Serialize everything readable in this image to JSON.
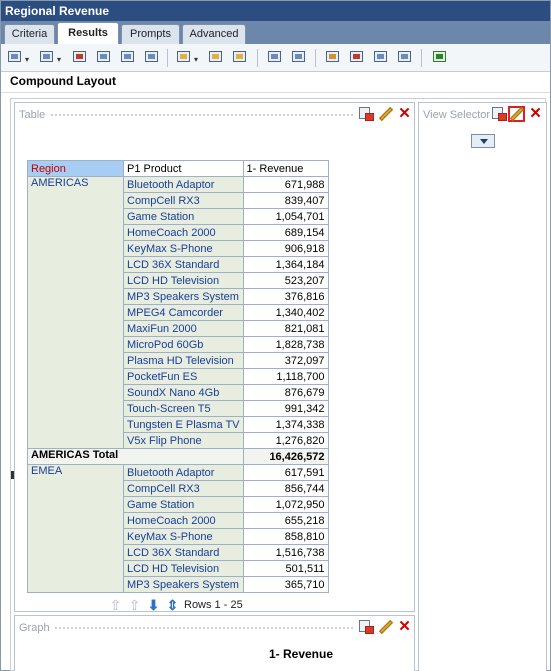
{
  "window": {
    "title": "Regional Revenue"
  },
  "tabs": [
    {
      "label": "Criteria",
      "active": false
    },
    {
      "label": "Results",
      "active": true
    },
    {
      "label": "Prompts",
      "active": false
    },
    {
      "label": "Advanced",
      "active": false
    }
  ],
  "toolbar_icons": [
    "print-icon",
    "export-icon",
    "schedule-icon",
    "preview-icon",
    "print-preview-icon",
    "refresh-icon",
    "new-view-icon",
    "add-view-icon",
    "new-layout-icon",
    "format-icon",
    "dashboard-icon",
    "rename-icon",
    "delete-icon",
    "align-icon",
    "duplicate-icon",
    "sort-icon"
  ],
  "layout": {
    "title": "Compound Layout"
  },
  "table_view": {
    "title": "Table",
    "columns": [
      "Region",
      "P1 Product",
      "1- Revenue"
    ],
    "groups": [
      {
        "region": "AMERICAS",
        "rows": [
          {
            "product": "Bluetooth Adaptor",
            "revenue": "671,988"
          },
          {
            "product": "CompCell RX3",
            "revenue": "839,407"
          },
          {
            "product": "Game Station",
            "revenue": "1,054,701"
          },
          {
            "product": "HomeCoach 2000",
            "revenue": "689,154"
          },
          {
            "product": "KeyMax S-Phone",
            "revenue": "906,918"
          },
          {
            "product": "LCD 36X Standard",
            "revenue": "1,364,184"
          },
          {
            "product": "LCD HD Television",
            "revenue": "523,207"
          },
          {
            "product": "MP3 Speakers System",
            "revenue": "376,816"
          },
          {
            "product": "MPEG4 Camcorder",
            "revenue": "1,340,402"
          },
          {
            "product": "MaxiFun 2000",
            "revenue": "821,081"
          },
          {
            "product": "MicroPod 60Gb",
            "revenue": "1,828,738"
          },
          {
            "product": "Plasma HD Television",
            "revenue": "372,097"
          },
          {
            "product": "PocketFun ES",
            "revenue": "1,118,700"
          },
          {
            "product": "SoundX Nano 4Gb",
            "revenue": "876,679"
          },
          {
            "product": "Touch-Screen T5",
            "revenue": "991,342"
          },
          {
            "product": "Tungsten E Plasma TV",
            "revenue": "1,374,338"
          },
          {
            "product": "V5x Flip Phone",
            "revenue": "1,276,820"
          }
        ],
        "total_label": "AMERICAS Total",
        "total_value": "16,426,572"
      },
      {
        "region": "EMEA",
        "rows": [
          {
            "product": "Bluetooth Adaptor",
            "revenue": "617,591"
          },
          {
            "product": "CompCell RX3",
            "revenue": "856,744"
          },
          {
            "product": "Game Station",
            "revenue": "1,072,950"
          },
          {
            "product": "HomeCoach 2000",
            "revenue": "655,218"
          },
          {
            "product": "KeyMax S-Phone",
            "revenue": "858,810"
          },
          {
            "product": "LCD 36X Standard",
            "revenue": "1,516,738"
          },
          {
            "product": "LCD HD Television",
            "revenue": "501,511"
          },
          {
            "product": "MP3 Speakers System",
            "revenue": "365,710"
          }
        ]
      }
    ],
    "pager_text": "Rows 1 - 25"
  },
  "view_selector": {
    "title": "View Selector"
  },
  "graph_view": {
    "title": "Graph",
    "chart_title": "1- Revenue"
  },
  "colors": {
    "titlebar": "#2b4d80",
    "tab_strip": "#6d87aa",
    "region_header_bg": "#a7cdf2",
    "region_header_text": "#c00000",
    "dimension_bg": "#e7eedf",
    "link_text": "#1a3c9c",
    "close_red": "#d10000"
  }
}
